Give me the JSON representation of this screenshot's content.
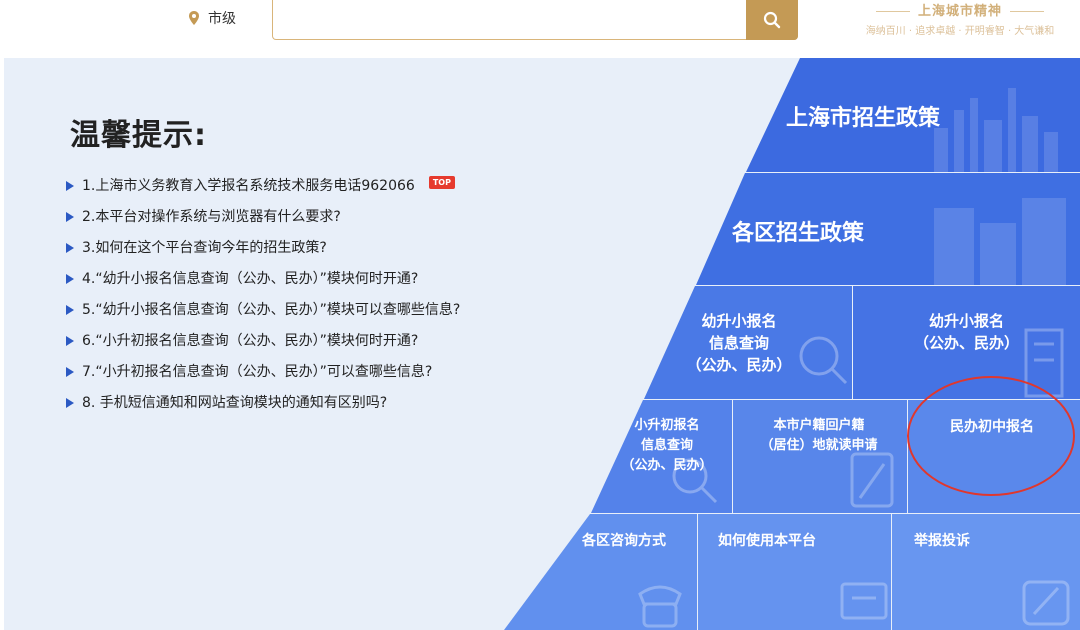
{
  "header": {
    "location": "市级",
    "search": {
      "placeholder": ""
    },
    "slogan": {
      "title": "上海城市精神",
      "subtitle": "海纳百川 · 追求卓越 · 开明睿智 · 大气谦和"
    }
  },
  "tips": {
    "title": "温馨提示:",
    "top_badge": "TOP",
    "items": [
      "1.上海市义务教育入学报名系统技术服务电话962066",
      "2.本平台对操作系统与浏览器有什么要求?",
      "3.如何在这个平台查询今年的招生政策?",
      "4.“幼升小报名信息查询（公办、民办）”模块何时开通?",
      "5.“幼升小报名信息查询（公办、民办）”模块可以查哪些信息?",
      "6.“小升初报名信息查询（公办、民办）”模块何时开通?",
      "7.“小升初报名信息查询（公办、民办）”可以查哪些信息?",
      "8. 手机短信通知和网站查询模块的通知有区别吗?"
    ]
  },
  "tiles": {
    "city_policy": "上海市招生政策",
    "district_policy": "各区招生政策",
    "primary_query": [
      "幼升小报名",
      "信息查询",
      "（公办、民办）"
    ],
    "primary_register": [
      "幼升小报名",
      "（公办、民办）"
    ],
    "middle_query": [
      "小升初报名",
      "信息查询",
      "（公办、民办）"
    ],
    "hukou_return": [
      "本市户籍回户籍",
      "（居住）地就读申请"
    ],
    "private_middle": "民办初中报名",
    "district_contact": "各区咨询方式",
    "how_to_use": "如何使用本平台",
    "report": "举报投诉"
  },
  "colors": {
    "gold": "#c49a55",
    "blue": "#3d6de0",
    "highlight": "#e0372d",
    "badge": "#e63a2e"
  }
}
